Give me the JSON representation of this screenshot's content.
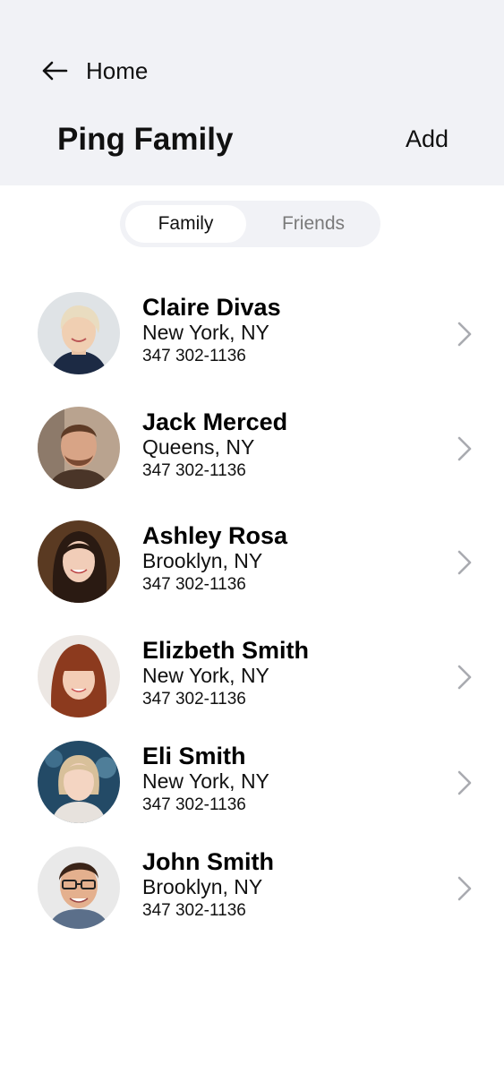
{
  "header": {
    "back_label": "Home",
    "title": "Ping Family",
    "add_label": "Add"
  },
  "tabs": [
    {
      "label": "Family",
      "active": true
    },
    {
      "label": "Friends",
      "active": false
    }
  ],
  "contacts": [
    {
      "name": "Claire Divas",
      "location": "New York, NY",
      "phone": "347 302-1136"
    },
    {
      "name": "Jack Merced",
      "location": "Queens, NY",
      "phone": "347 302-1136"
    },
    {
      "name": "Ashley Rosa",
      "location": "Brooklyn, NY",
      "phone": "347 302-1136"
    },
    {
      "name": "Elizbeth Smith",
      "location": "New York, NY",
      "phone": "347 302-1136"
    },
    {
      "name": "Eli Smith",
      "location": "New York, NY",
      "phone": "347 302-1136"
    },
    {
      "name": "John Smith",
      "location": "Brooklyn, NY",
      "phone": "347 302-1136"
    }
  ],
  "colors": {
    "header_bg": "#f1f2f6",
    "chevron": "#a9abb0",
    "inactive_tab_text": "#7a7a7a"
  },
  "icons": {
    "back": "arrow-left-icon",
    "row_chevron": "chevron-right-icon"
  }
}
